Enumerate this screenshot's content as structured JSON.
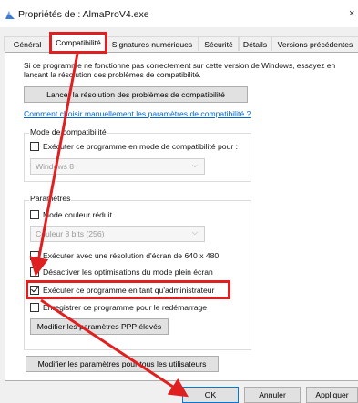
{
  "window": {
    "title": "Propriétés de : AlmaProV4.exe",
    "close_glyph": "×"
  },
  "tabs": [
    {
      "label": "Général",
      "active": false
    },
    {
      "label": "Compatibilité",
      "active": true
    },
    {
      "label": "Signatures numériques",
      "active": false
    },
    {
      "label": "Sécurité",
      "active": false
    },
    {
      "label": "Détails",
      "active": false
    },
    {
      "label": "Versions précédentes",
      "active": false
    }
  ],
  "intro": {
    "text": "Si ce programme ne fonctionne pas correctement sur cette version de Windows, essayez en lançant la résolution des problèmes de compatibilité.",
    "troubleshoot_button": "Lancer la résolution des problèmes de compatibilité",
    "manual_link": "Comment choisir manuellement les paramètres de compatibilité ?"
  },
  "compat_mode": {
    "legend": "Mode de compatibilité",
    "checkbox_label": "Exécuter ce programme en mode de compatibilité pour :",
    "checked": false,
    "select_value": "Windows 8"
  },
  "settings": {
    "legend": "Paramètres",
    "reduced_color": {
      "label": "Mode couleur réduit",
      "checked": false
    },
    "color_select_value": "Couleur 8 bits (256)",
    "resolution_640": {
      "label": "Exécuter avec une résolution d'écran de 640 x 480",
      "checked": false
    },
    "disable_fullscreen": {
      "label": "Désactiver les optimisations du mode plein écran",
      "checked": false
    },
    "run_as_admin": {
      "label": "Exécuter ce programme en tant qu'administrateur",
      "checked": true
    },
    "register_restart": {
      "label": "Enregistrer ce programme pour le redémarrage",
      "checked": false
    },
    "dpi_button": "Modifier les paramètres PPP élevés"
  },
  "all_users_button": "Modifier les paramètres pour tous les utilisateurs",
  "footer": {
    "ok": "OK",
    "cancel": "Annuler",
    "apply": "Appliquer"
  },
  "colors": {
    "highlight": "#e02020",
    "link": "#0066cc"
  },
  "icons": [
    "app-icon",
    "checkmark-icon",
    "chevron-down-icon",
    "close-icon",
    "arrow-annotation"
  ]
}
